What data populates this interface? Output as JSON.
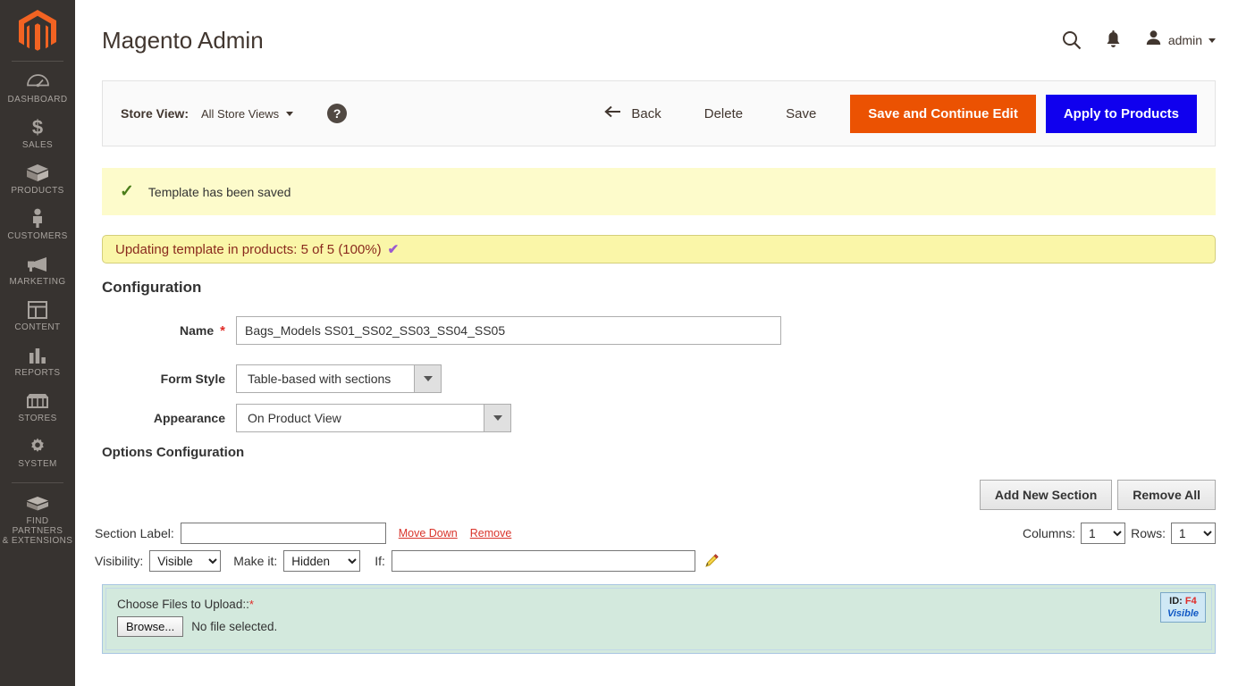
{
  "sidebar": {
    "logo_name": "magento-logo",
    "items": [
      {
        "label": "DASHBOARD",
        "icon": "dashboard-icon"
      },
      {
        "label": "SALES",
        "icon": "dollar-icon"
      },
      {
        "label": "PRODUCTS",
        "icon": "box-icon"
      },
      {
        "label": "CUSTOMERS",
        "icon": "person-icon"
      },
      {
        "label": "MARKETING",
        "icon": "megaphone-icon"
      },
      {
        "label": "CONTENT",
        "icon": "layout-icon"
      },
      {
        "label": "REPORTS",
        "icon": "bar-chart-icon"
      },
      {
        "label": "STORES",
        "icon": "storefront-icon"
      },
      {
        "label": "SYSTEM",
        "icon": "gear-icon"
      },
      {
        "label": "FIND PARTNERS\n& EXTENSIONS",
        "icon": "extension-icon"
      }
    ]
  },
  "header": {
    "title": "Magento Admin",
    "search_icon": "search-icon",
    "notifications_icon": "bell-icon",
    "avatar_icon": "user-avatar-icon",
    "user_name": "admin"
  },
  "toolbar": {
    "store_view_label": "Store View:",
    "store_view_value": "All Store Views",
    "help_icon_text": "?",
    "back_label": "Back",
    "delete_label": "Delete",
    "save_label": "Save",
    "save_continue_label": "Save and Continue Edit",
    "apply_products_label": "Apply to Products",
    "orange_color": "#eb5202",
    "blue_color": "#1000ee"
  },
  "messages": {
    "success_text": "Template has been saved",
    "success_icon": "check-icon",
    "progress_text": "Updating template in products: 5 of 5 (100%)",
    "progress_icon": "check-icon",
    "progress_percent": "100%",
    "progress_count": "5 of 5"
  },
  "configuration": {
    "heading": "Configuration",
    "name_label": "Name",
    "name_required": "*",
    "name_value": "Bags_Models SS01_SS02_SS03_SS04_SS05",
    "name_placeholder": "",
    "form_style_label": "Form Style",
    "form_style_value": "Table-based with sections",
    "appearance_label": "Appearance",
    "appearance_value": "On Product View",
    "options_heading": "Options Configuration"
  },
  "section_toolbar": {
    "add_new_section_label": "Add New Section",
    "remove_all_label": "Remove All"
  },
  "section": {
    "section_label_text": "Section Label:",
    "section_label_value": "",
    "move_down_label": "Move Down",
    "remove_label": "Remove",
    "columns_label": "Columns:",
    "columns_value": "1",
    "rows_label": "Rows:",
    "rows_value": "1",
    "visibility_label": "Visibility:",
    "visibility_value": "Visible",
    "make_it_label": "Make it:",
    "make_it_value": "Hidden",
    "if_label": "If:",
    "if_value": "",
    "edit_icon": "pencil-icon"
  },
  "file_field": {
    "label": "Choose Files to Upload::",
    "required": "*",
    "browse_label": "Browse...",
    "no_file_text": "No file selected.",
    "id_prefix": "ID:",
    "id_value": "F4",
    "visibility_badge": "Visible"
  }
}
